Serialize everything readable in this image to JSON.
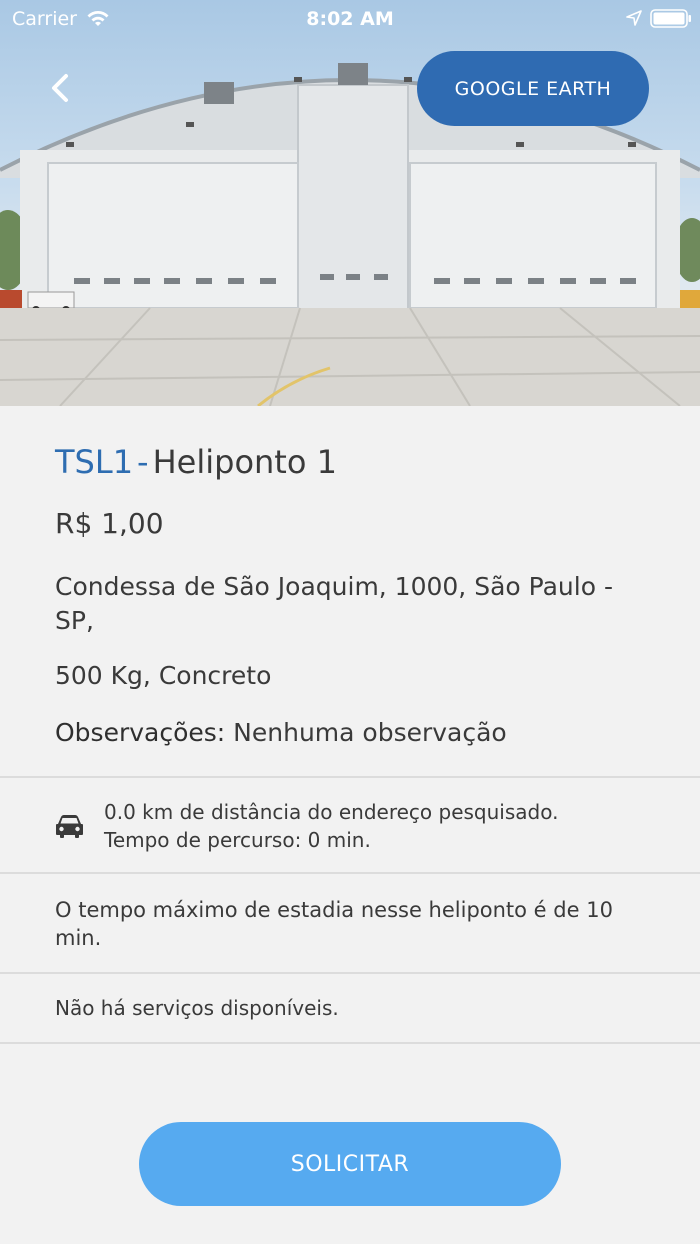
{
  "status_bar": {
    "carrier": "Carrier",
    "time": "8:02 AM"
  },
  "header": {
    "google_earth_label": "GOOGLE EARTH"
  },
  "heliport": {
    "code": "TSL1",
    "separator": "-",
    "name": "Heliponto 1",
    "price": "R$ 1,00",
    "address": "Condessa de São Joaquim, 1000, São Paulo - SP,",
    "specs": "500 Kg, Concreto",
    "observations_label": "Observações:",
    "observations_value": "Nenhuma observação"
  },
  "distance": {
    "line1": "0.0 km de distância do endereço pesquisado.",
    "line2": "Tempo de percurso: 0 min."
  },
  "stay_info": "O tempo máximo de estadia nesse heliponto é de 10 min.",
  "services_info": "Não há serviços disponíveis.",
  "actions": {
    "request_label": "SOLICITAR"
  },
  "colors": {
    "primary": "#2f6bb2",
    "accent_button": "#56aaf0",
    "background": "#f2f2f2",
    "code_text": "#2e6db1"
  },
  "icons": [
    "wifi-icon",
    "location-arrow-icon",
    "battery-icon",
    "back-chevron-icon",
    "car-icon"
  ]
}
